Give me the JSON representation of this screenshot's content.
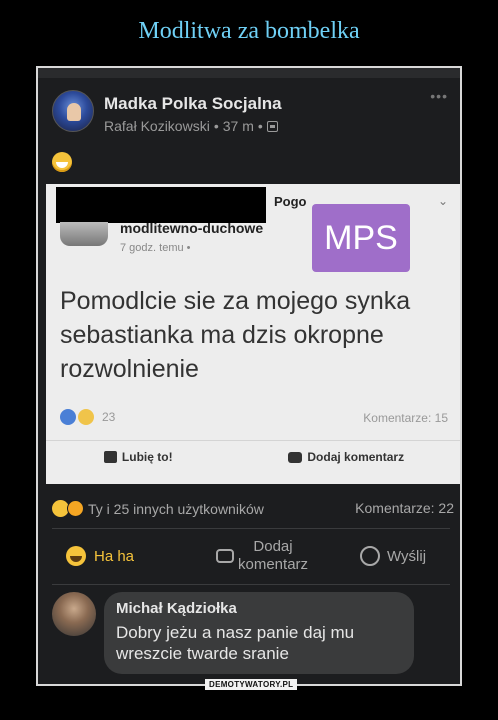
{
  "poster": {
    "title": "Modlitwa za bombelka",
    "footer": "DEMOTYWATORY.PL"
  },
  "post": {
    "page_name": "Madka Polka Socjalna",
    "author": "Rafał Kozikowski",
    "time": "37 m",
    "separator": "•"
  },
  "embedded": {
    "pogo_fragment": "Pogo",
    "page_name": "modlitewno-duchowe",
    "time": "7 godz. temu •",
    "badge": "MPS",
    "text": "Pomodlcie sie za mojego synka sebastianka ma dzis okropne rozwolnienie",
    "reaction_count": "23",
    "comments": "Komentarze: 15",
    "like_label": "Lubię to!",
    "comment_label": "Dodaj komentarz"
  },
  "reactions": {
    "summary": "Ty i 25 innych użytkowników",
    "comments": "Komentarze: 22"
  },
  "actions": {
    "haha": "Ha ha",
    "comment_line1": "Dodaj",
    "comment_line2": "komentarz",
    "send": "Wyślij"
  },
  "comment": {
    "author": "Michał Kądziołka",
    "text": "Dobry jeżu a nasz panie daj mu wreszcie twarde sranie"
  },
  "colors": {
    "title": "#6fd0f5",
    "haha": "#f5c33b",
    "mps": "#9f6ec9"
  }
}
